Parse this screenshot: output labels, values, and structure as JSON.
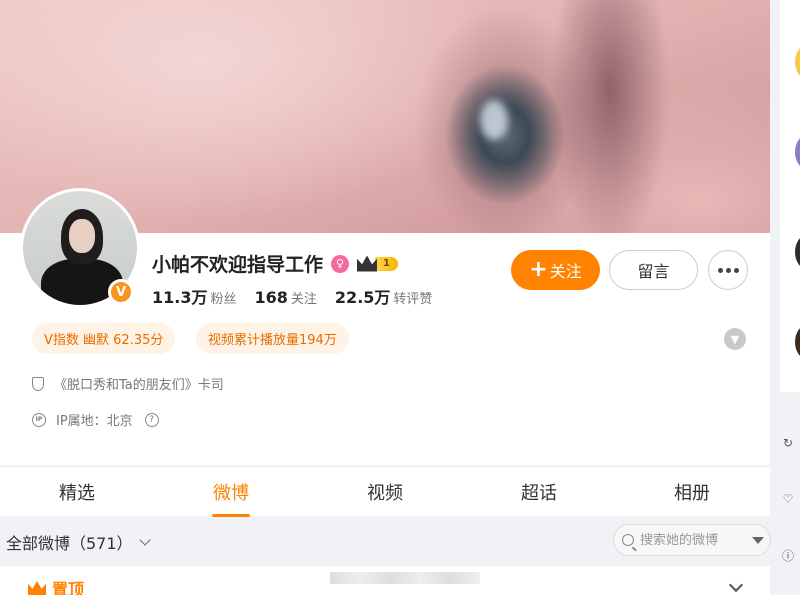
{
  "profile": {
    "name": "小帕不欢迎指导工作",
    "level": "1",
    "verified_mark": "V",
    "stats": [
      {
        "num": "11.3万",
        "label": "粉丝"
      },
      {
        "num": "168",
        "label": "关注"
      },
      {
        "num": "22.5万",
        "label": "转评赞"
      }
    ]
  },
  "actions": {
    "follow_plus": "+",
    "follow_label": "关注",
    "message_label": "留言"
  },
  "tags": {
    "v_index": "V指数 幽默 62.35分",
    "video_plays": "视频累计播放量194万"
  },
  "info": {
    "work": "《脱口秀和Ta的朋友们》卡司",
    "ip_icon_text": "IP",
    "ip_location": "IP属地：北京",
    "help_text": "?"
  },
  "tabs": [
    {
      "label": "精选"
    },
    {
      "label": "微博"
    },
    {
      "label": "视频"
    },
    {
      "label": "超话"
    },
    {
      "label": "相册"
    }
  ],
  "active_tab": "微博",
  "feed": {
    "filter_label": "全部微博（571）",
    "search_placeholder": "搜索她的微博",
    "pinned_label": "置顶"
  },
  "colors": {
    "accent": "#ff8200",
    "tag_bg": "#fff3e6",
    "tag_text": "#e66c00"
  },
  "icons": [
    "gender-female-icon",
    "crown-icon",
    "more-icon",
    "chevron-down-icon",
    "shield-icon",
    "ip-icon",
    "help-icon",
    "search-icon",
    "caret-down-icon",
    "pin-crown-icon"
  ]
}
